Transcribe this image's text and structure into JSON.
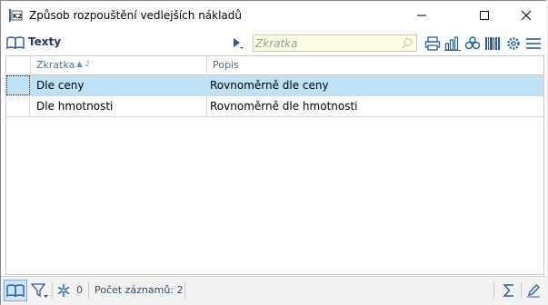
{
  "window": {
    "title": "Způsob rozpouštění vedlejších nákladů",
    "app_icon": "k2-app-icon",
    "controls": [
      "minimize-icon",
      "maximize-icon",
      "close-icon"
    ]
  },
  "toolbar": {
    "section_label": "Texty",
    "search_placeholder": "Zkratka",
    "search_value": "",
    "icons": [
      "book-icon",
      "play-dropdown-icon",
      "magnifier-icon",
      "printer-icon",
      "bar-chart-icon",
      "binoculars-icon",
      "barcode-icon",
      "gear-icon",
      "menu-icon"
    ]
  },
  "table": {
    "columns": [
      {
        "label": "Zkratka",
        "sort_indicator": "▲",
        "sort_order": "2"
      },
      {
        "label": "Popis"
      }
    ],
    "rows": [
      {
        "zkratka": "Dle ceny",
        "popis": "Rovnoměrně dle ceny",
        "selected": true
      },
      {
        "zkratka": "Dle hmotnosti",
        "popis": "Rovnoměrně dle hmotnosti",
        "selected": false
      }
    ]
  },
  "statusbar": {
    "filter_count": "0",
    "record_count_text": "Počet záznamů: 2",
    "icons": [
      "book-icon",
      "filter-icon",
      "snowflake-icon",
      "sigma-icon",
      "pencil-icon"
    ]
  },
  "colors": {
    "selection": "#bfe1f5",
    "header_text": "#4e6f9a",
    "accent": "#1f5fa8",
    "search_bg": "#fdfde6"
  }
}
